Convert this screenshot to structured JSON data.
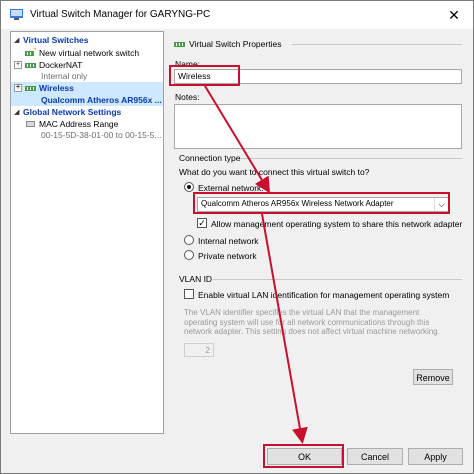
{
  "window": {
    "title": "Virtual Switch Manager for GARYNG-PC",
    "close_glyph": "✕"
  },
  "tree": {
    "virtual_switches_header": "Virtual Switches",
    "items": [
      {
        "label": "New virtual network switch",
        "icon": "new-switch-icon"
      },
      {
        "label": "DockerNAT",
        "sub": "Internal only",
        "icon": "network-switch-icon"
      },
      {
        "label": "Wireless",
        "sub": "Qualcomm Atheros AR956x ...",
        "icon": "network-switch-icon"
      }
    ],
    "global_settings_header": "Global Network Settings",
    "mac_item": {
      "label": "MAC Address Range",
      "sub": "00-15-5D-38-01-00 to 00-15-5..."
    }
  },
  "properties": {
    "section_title": "Virtual Switch Properties",
    "name_label": "Name:",
    "name_value": "Wireless",
    "notes_label": "Notes:",
    "notes_value": "",
    "connection_type_title": "Connection type",
    "connection_question": "What do you want to connect this virtual switch to?",
    "external_label": "External network:",
    "adapter_value": "Qualcomm Atheros AR956x Wireless Network Adapter",
    "allow_mgmt_label": "Allow management operating system to share this network adapter",
    "internal_label": "Internal network",
    "private_label": "Private network",
    "vlan_title": "VLAN ID",
    "vlan_enable_label": "Enable virtual LAN identification for management operating system",
    "vlan_description": "The VLAN identifier specifies the virtual LAN that the management operating system will use for all network communications through this network adapter. This setting does not affect virtual machine networking.",
    "vlan_id_value": "2",
    "remove_label": "Remove"
  },
  "footer": {
    "ok_label": "OK",
    "cancel_label": "Cancel",
    "apply_label": "Apply"
  },
  "colors": {
    "highlight": "#c8102e",
    "tree_header": "#0b3aa6",
    "selection": "#cde8ff"
  }
}
